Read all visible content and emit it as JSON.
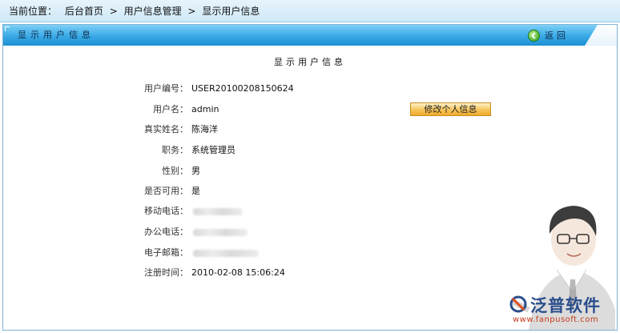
{
  "breadcrumb": {
    "prefix": "当前位置：",
    "items": [
      "后台首页",
      "用户信息管理",
      "显示用户信息"
    ],
    "separator": ">"
  },
  "panel": {
    "title": "显示用户信息",
    "back_label": "返回",
    "content_title": "显示用户信息",
    "edit_button": "修改个人信息"
  },
  "user": {
    "fields": [
      {
        "label": "用户编号：",
        "value": "USER20100208150624"
      },
      {
        "label": "用户名：",
        "value": "admin"
      },
      {
        "label": "真实姓名：",
        "value": "陈海洋"
      },
      {
        "label": "职务：",
        "value": "系统管理员"
      },
      {
        "label": "性别：",
        "value": "男"
      },
      {
        "label": "是否可用：",
        "value": "是"
      },
      {
        "label": "移动电话：",
        "value": ""
      },
      {
        "label": "办公电话：",
        "value": ""
      },
      {
        "label": "电子邮箱：",
        "value": ""
      },
      {
        "label": "注册时间：",
        "value": "2010-02-08 15:06:24"
      }
    ]
  },
  "watermark": {
    "brand": "泛普软件",
    "url": "www.fanpusoft.com"
  },
  "colors": {
    "header_blue": "#39a9e6",
    "button_orange": "#f7c45a",
    "back_green": "#2f9d1f"
  }
}
